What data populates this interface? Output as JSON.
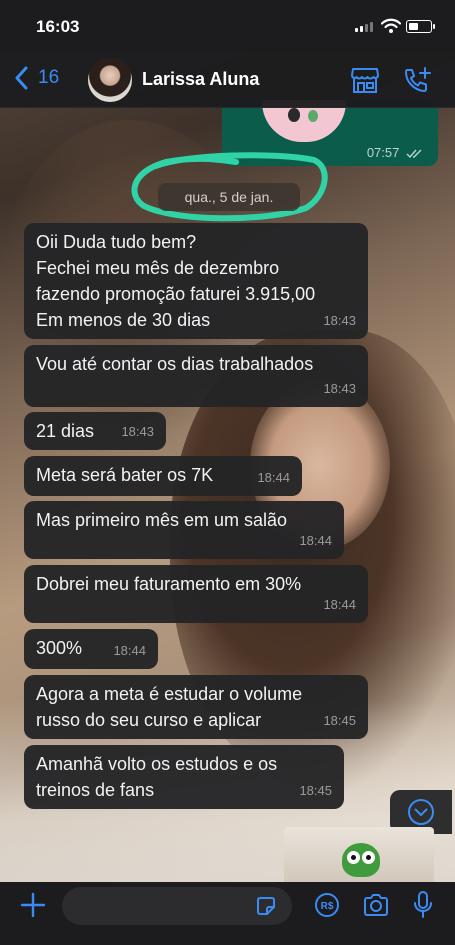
{
  "status_bar": {
    "time": "16:03"
  },
  "header": {
    "back_count": "16",
    "contact_name": "Larissa Aluna"
  },
  "outgoing_message": {
    "time": "07:57"
  },
  "date_separator": "qua., 5 de jan.",
  "messages": [
    {
      "text": "Oii Duda tudo bem?\nFechei meu mês de dezembro\nfazendo promoção faturei 3.915,00\nEm menos de 30 dias",
      "time": "18:43"
    },
    {
      "text": "Vou até contar os dias trabalhados",
      "time": "18:43"
    },
    {
      "text": "21 dias",
      "time": "18:43"
    },
    {
      "text": "Meta será bater os 7K",
      "time": "18:44"
    },
    {
      "text": "Mas primeiro mês em um salão",
      "time": "18:44"
    },
    {
      "text": "Dobrei meu faturamento em 30%",
      "time": "18:44"
    },
    {
      "text": "300%",
      "time": "18:44"
    },
    {
      "text": "Agora a meta é estudar o volume\nrusso do seu curso e aplicar",
      "time": "18:45"
    },
    {
      "text": "Amanhã volto os estudos e  os\ntreinos de fans",
      "time": "18:45"
    }
  ],
  "icons": {
    "back": "chevron-left-icon",
    "store": "store-icon",
    "call": "phone-plus-icon",
    "attach": "plus-icon",
    "sticker": "sticker-icon",
    "payment": "pix-rs-icon",
    "camera": "camera-icon",
    "mic": "microphone-icon",
    "scroll": "chevron-down-circle-icon"
  },
  "colors": {
    "accent": "#3b8bf5",
    "bubble": "#242426",
    "outgoing": "#0b5c4a",
    "annotation": "#2fd3a6"
  }
}
